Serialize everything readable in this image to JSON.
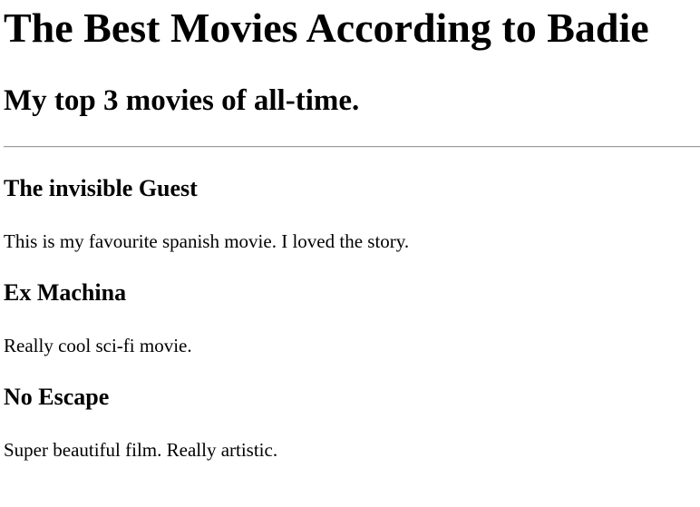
{
  "header": {
    "title": "The Best Movies According to Badie",
    "subtitle": "My top 3 movies of all-time."
  },
  "movies": [
    {
      "title": "The invisible Guest",
      "description": "This is my favourite spanish movie. I loved the story."
    },
    {
      "title": "Ex Machina",
      "description": "Really cool sci-fi movie."
    },
    {
      "title": "No Escape",
      "description": "Super beautiful film. Really artistic."
    }
  ]
}
